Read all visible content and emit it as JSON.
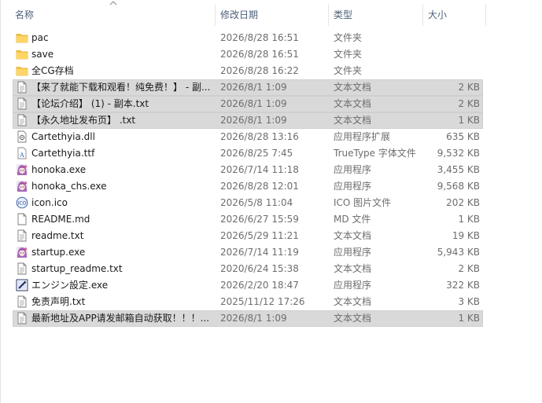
{
  "columns": {
    "name": "名称",
    "date": "修改日期",
    "type": "类型",
    "size": "大小"
  },
  "files": [
    {
      "name": "pac",
      "date": "2026/8/28 16:51",
      "type": "文件夹",
      "size": "",
      "icon": "folder-icon",
      "selected": false
    },
    {
      "name": "save",
      "date": "2026/8/28 16:51",
      "type": "文件夹",
      "size": "",
      "icon": "folder-icon",
      "selected": false
    },
    {
      "name": "全CG存档",
      "date": "2026/8/28 16:22",
      "type": "文件夹",
      "size": "",
      "icon": "folder-icon",
      "selected": false
    },
    {
      "name": "【来了就能下载和观看！纯免费！】 - 副...",
      "date": "2026/8/1 1:09",
      "type": "文本文档",
      "size": "2 KB",
      "icon": "text-file-icon",
      "selected": true
    },
    {
      "name": "【论坛介绍】 (1) - 副本.txt",
      "date": "2026/8/1 1:09",
      "type": "文本文档",
      "size": "2 KB",
      "icon": "text-file-icon",
      "selected": true
    },
    {
      "name": "【永久地址发布页】 .txt",
      "date": "2026/8/1 1:09",
      "type": "文本文档",
      "size": "1 KB",
      "icon": "text-file-icon",
      "selected": true
    },
    {
      "name": "Cartethyia.dll",
      "date": "2026/8/28 13:16",
      "type": "应用程序扩展",
      "size": "635 KB",
      "icon": "dll-icon",
      "selected": false
    },
    {
      "name": "Cartethyia.ttf",
      "date": "2026/8/25 7:45",
      "type": "TrueType 字体文件",
      "size": "9,532 KB",
      "icon": "font-file-icon",
      "selected": false
    },
    {
      "name": "honoka.exe",
      "date": "2026/7/14 11:18",
      "type": "应用程序",
      "size": "3,455 KB",
      "icon": "anime-app-icon",
      "selected": false
    },
    {
      "name": "honoka_chs.exe",
      "date": "2026/8/28 12:01",
      "type": "应用程序",
      "size": "9,568 KB",
      "icon": "anime-app-icon",
      "selected": false
    },
    {
      "name": "icon.ico",
      "date": "2026/5/8 11:04",
      "type": "ICO 图片文件",
      "size": "202 KB",
      "icon": "ico-file-icon",
      "selected": false
    },
    {
      "name": "README.md",
      "date": "2026/6/27 15:59",
      "type": "MD 文件",
      "size": "1 KB",
      "icon": "blank-file-icon",
      "selected": false
    },
    {
      "name": "readme.txt",
      "date": "2026/5/29 11:21",
      "type": "文本文档",
      "size": "19 KB",
      "icon": "text-file-icon",
      "selected": false
    },
    {
      "name": "startup.exe",
      "date": "2026/7/14 11:19",
      "type": "应用程序",
      "size": "5,943 KB",
      "icon": "anime-app-icon",
      "selected": false
    },
    {
      "name": "startup_readme.txt",
      "date": "2020/6/24 15:38",
      "type": "文本文档",
      "size": "2 KB",
      "icon": "text-file-icon",
      "selected": false
    },
    {
      "name": "エンジン設定.exe",
      "date": "2026/2/20 18:47",
      "type": "应用程序",
      "size": "322 KB",
      "icon": "settings-app-icon",
      "selected": false
    },
    {
      "name": "免责声明.txt",
      "date": "2025/11/12 17:26",
      "type": "文本文档",
      "size": "3 KB",
      "icon": "text-file-icon",
      "selected": false
    },
    {
      "name": "最新地址及APP请发邮箱自动获取！！！...",
      "date": "2026/8/1 1:09",
      "type": "文本文档",
      "size": "1 KB",
      "icon": "text-file-icon",
      "selected": true
    }
  ]
}
